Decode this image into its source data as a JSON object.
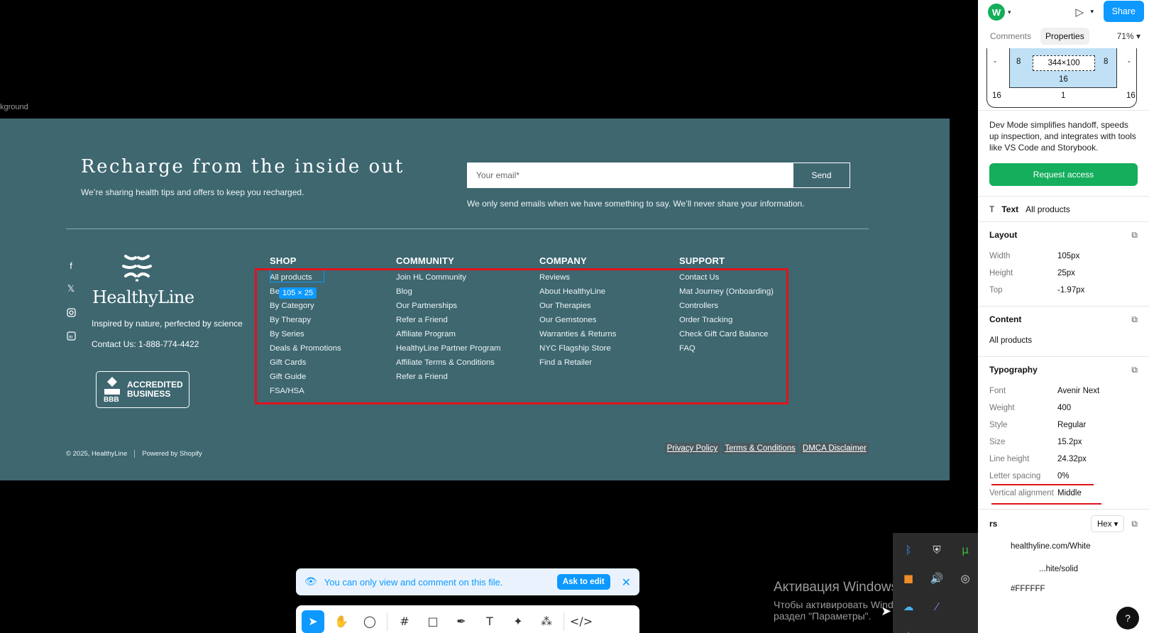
{
  "canvas": {
    "frame_label": "kground",
    "newsletter": {
      "title": "Recharge from the inside out",
      "subtitle": "We’re sharing health tips and offers to keep you recharged.",
      "email_placeholder": "Your email*",
      "send_label": "Send",
      "note": "We only send emails when we have something to say. We’ll never share your information."
    },
    "social_icons": [
      "facebook-icon",
      "x-icon",
      "instagram-icon",
      "linkedin-icon"
    ],
    "brand": {
      "name": "HealthyLine",
      "tagline": "Inspired by nature, perfected by science",
      "contact": "Contact Us: 1-888-774-4422",
      "bbb": {
        "line1": "ACCREDITED",
        "line2": "BUSINESS",
        "mark": "BBB"
      }
    },
    "menus": [
      {
        "title": "SHOP",
        "items": [
          "All products",
          "Best Sellers",
          "By Category",
          "By Therapy",
          "By Series",
          "Deals & Promotions",
          "Gift Cards",
          "Gift Guide",
          "FSA/HSA"
        ]
      },
      {
        "title": "COMMUNITY",
        "items": [
          "Join HL Community",
          "Blog",
          "Our Partnerships",
          "Refer a Friend",
          "Affiliate Program",
          "HealthyLine Partner Program",
          "Affiliate Terms & Conditions",
          "Refer a Friend"
        ]
      },
      {
        "title": "COMPANY",
        "items": [
          "Reviews",
          "About HealthyLine",
          "Our Therapies",
          "Our Gemstones",
          "Warranties & Returns",
          "NYC Flagship Store",
          "Find a Retailer"
        ]
      },
      {
        "title": "SUPPORT",
        "items": [
          "Contact Us",
          "Mat Journey (Onboarding)",
          "Controllers",
          "Order Tracking",
          "Check Gift Card Balance",
          "FAQ"
        ]
      }
    ],
    "selection_badge": "105 × 25",
    "copyright": "© 2025, HealthyLine",
    "powered_by": "Powered by Shopify",
    "legal_links": [
      "Privacy Policy",
      "Terms & Conditions",
      "DMCA Disclaimer"
    ]
  },
  "toast": {
    "message": "You can only view and comment on this file.",
    "ask_label": "Ask to edit"
  },
  "toolbar": {
    "tools": [
      "move-tool-icon",
      "hand-tool-icon",
      "comment-tool-icon",
      "frame-tool-icon",
      "shape-tool-icon",
      "pen-tool-icon",
      "text-tool-icon",
      "component-tool-icon",
      "actions-tool-icon",
      "dev-mode-icon"
    ]
  },
  "windows": {
    "activation_title": "Активация Windows",
    "activation_sub": "Чтобы активировать Windows, перейдите в раздел \"Параметры\"."
  },
  "panel": {
    "avatar": "W",
    "share_label": "Share",
    "tabs": [
      "Comments",
      "Properties"
    ],
    "active_tab": "Properties",
    "zoom": "71%",
    "box_model": {
      "content_size": "344×100",
      "padding_left": "8",
      "padding_right": "8",
      "padding_bottom": "16",
      "margin_left": "-",
      "margin_right": "-",
      "outer_left": "16",
      "outer_bottom": "1",
      "outer_right": "16"
    },
    "dev_mode_text": "Dev Mode simplifies handoff, speeds up inspection, and integrates with tools like VS Code and Storybook.",
    "request_label": "Request access",
    "text_layer": {
      "type": "Text",
      "name": "All products"
    },
    "layout": {
      "title": "Layout",
      "rows": [
        {
          "k": "Width",
          "v": "105px"
        },
        {
          "k": "Height",
          "v": "25px"
        },
        {
          "k": "Top",
          "v": "-1.97px"
        }
      ]
    },
    "content": {
      "title": "Content",
      "value": "All products"
    },
    "typography": {
      "title": "Typography",
      "rows": [
        {
          "k": "Font",
          "v": "Avenir Next"
        },
        {
          "k": "Weight",
          "v": "400"
        },
        {
          "k": "Style",
          "v": "Regular"
        },
        {
          "k": "Size",
          "v": "15.2px"
        },
        {
          "k": "Line height",
          "v": "24.32px"
        },
        {
          "k": "Letter spacing",
          "v": "0%"
        },
        {
          "k": "Vertical alignment",
          "v": "Middle"
        }
      ]
    },
    "colors": {
      "title": "rs",
      "format": "Hex",
      "token": "healthyline.com/White",
      "token_sub": "...hite/solid",
      "hex": "#FFFFFF"
    },
    "help": "?"
  }
}
